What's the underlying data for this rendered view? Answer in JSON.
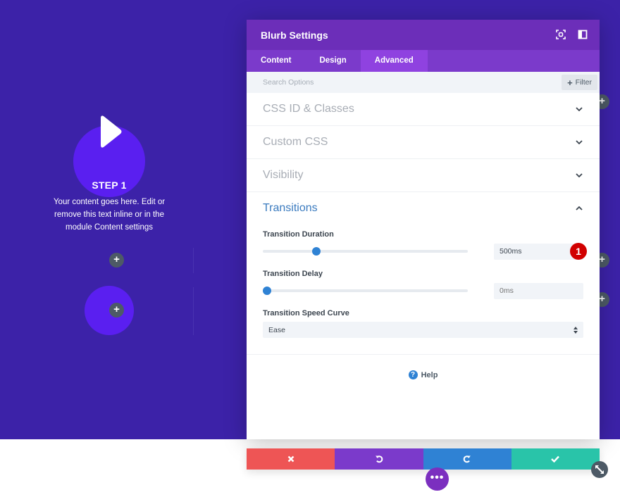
{
  "colors": {
    "page_bg": "#3c22a8",
    "header": "#6c2eb9",
    "tabs_bg": "#7b3acb",
    "tab_active": "#8f42e0",
    "accent_blue": "#2f82d4",
    "cancel": "#ee5555",
    "undo": "#7b3acb",
    "redo": "#2f82d4",
    "save": "#29c4a9",
    "badge": "#d10000"
  },
  "preview": {
    "step_title": "STEP 1",
    "step_text": "Your content goes here. Edit or remove this text inline or in the module Content settings",
    "play_icon": "play-icon",
    "add_module_icon": "plus-icon"
  },
  "modal": {
    "title": "Blurb Settings",
    "header_icons": [
      "fullscreen-icon",
      "sidebar-layout-icon"
    ],
    "tabs": [
      {
        "label": "Content",
        "active": false
      },
      {
        "label": "Design",
        "active": false
      },
      {
        "label": "Advanced",
        "active": true
      }
    ],
    "search": {
      "placeholder": "Search Options",
      "value": ""
    },
    "filter_label": "Filter",
    "sections": [
      {
        "title": "CSS ID & Classes",
        "expanded": false
      },
      {
        "title": "Custom CSS",
        "expanded": false
      },
      {
        "title": "Visibility",
        "expanded": false
      }
    ],
    "transitions": {
      "title": "Transitions",
      "expanded": true,
      "duration": {
        "label": "Transition Duration",
        "value": "500ms",
        "slider_fraction": 0.25
      },
      "delay": {
        "label": "Transition Delay",
        "value": "",
        "placeholder": "0ms",
        "slider_fraction": 0.0
      },
      "speed_curve": {
        "label": "Transition Speed Curve",
        "selected": "Ease"
      },
      "annotation_badge": "1"
    },
    "help_label": "Help"
  },
  "action_bar": {
    "cancel_icon": "close-icon",
    "undo_icon": "undo-icon",
    "redo_icon": "redo-icon",
    "save_icon": "check-icon",
    "more_icon": "more-dots-icon",
    "resize_icon": "resize-icon"
  }
}
